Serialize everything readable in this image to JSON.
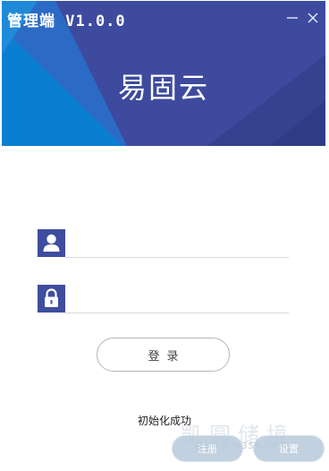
{
  "window": {
    "title": "管理端 V1.0.0",
    "minimize_icon": "minimize-icon",
    "close_icon": "close-icon"
  },
  "banner": {
    "brand_name": "易固云",
    "colors": {
      "base": "#3d4a9e",
      "light_blue": "#0a7fd2",
      "mid_blue": "#2b6bc6",
      "dark_band": "#34428f"
    }
  },
  "form": {
    "username": {
      "icon": "user-icon",
      "value": "",
      "placeholder": ""
    },
    "password": {
      "icon": "lock-icon",
      "value": "",
      "placeholder": ""
    },
    "login_label": "登录"
  },
  "status": {
    "message": "初始化成功"
  },
  "watermark": {
    "text": "凯圆储境",
    "url": "www.pc0359.cn",
    "left_button_label": "注册",
    "right_button_label": "设置"
  },
  "theme": {
    "accent": "#3f4d9f",
    "underline": "#d9d9d9",
    "button_border": "#b5b5b5"
  }
}
